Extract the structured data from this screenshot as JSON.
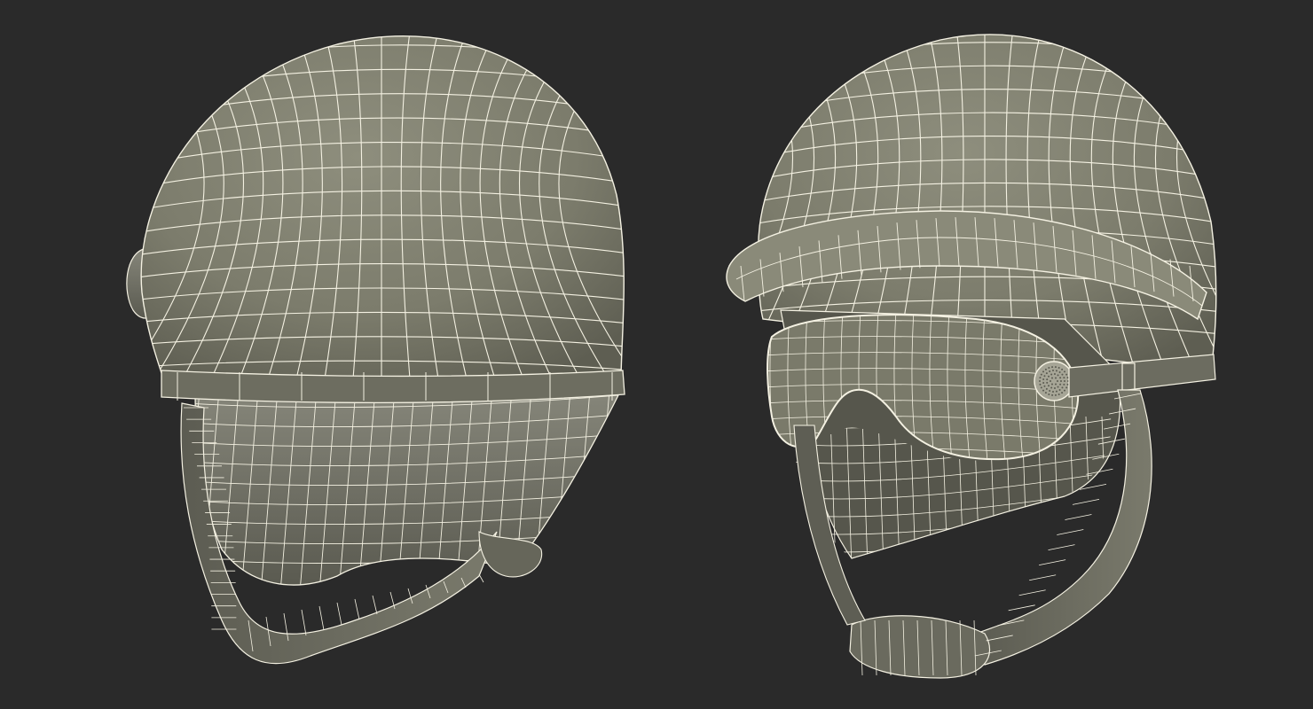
{
  "scene": {
    "background_color": "#2a2a2a",
    "shell_color": "#80806f",
    "shell_shadow_color": "#5e5e52",
    "shell_highlight_color": "#8e8e7d",
    "wire_color": "#f4f1e2",
    "objects": [
      {
        "name": "helmet-rear-view",
        "icon": "helmet-icon"
      },
      {
        "name": "helmet-front-view-with-goggles",
        "icon": "helmet-goggles-icon"
      }
    ]
  }
}
